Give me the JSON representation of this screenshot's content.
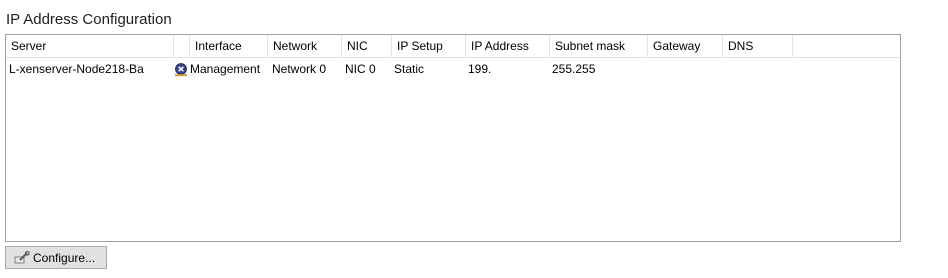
{
  "section": {
    "title": "IP Address Configuration"
  },
  "grid": {
    "columns": [
      "Server",
      "",
      "Interface",
      "Network",
      "NIC",
      "IP Setup",
      "IP Address",
      "Subnet mask",
      "Gateway",
      "DNS"
    ],
    "rows": [
      {
        "server": "L-xenserver-Node218-Ba",
        "interface": "Management",
        "network": "Network 0",
        "nic": "NIC 0",
        "ip_setup": "Static",
        "ip_address": "199.",
        "subnet_mask": "255.255",
        "gateway": "",
        "dns": ""
      }
    ]
  },
  "buttons": {
    "configure_label": "Configure..."
  },
  "icons": {
    "interface": "network-interface-icon",
    "configure": "configure-wrench-icon"
  }
}
